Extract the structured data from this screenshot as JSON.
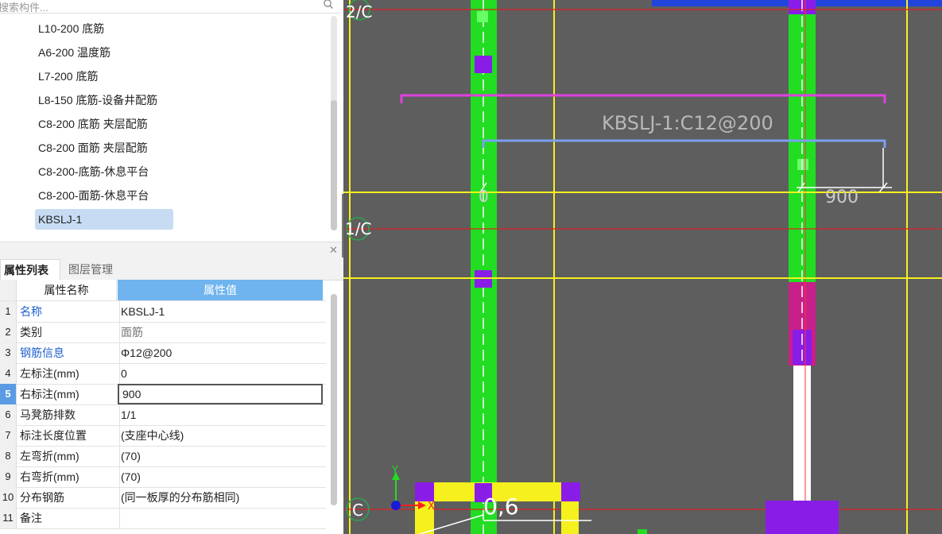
{
  "search": {
    "placeholder": "搜索构件..."
  },
  "tree": {
    "items": [
      "L10-200 底筋",
      "A6-200 温度筋",
      "L7-200 底筋",
      "L8-150 底筋-设备井配筋",
      "C8-200 底筋 夹层配筋",
      "C8-200 面筋 夹层配筋",
      "C8-200-底筋-休息平台",
      "C8-200-面筋-休息平台",
      "KBSLJ-1"
    ],
    "selected": "KBSLJ-1"
  },
  "tabs": {
    "properties": "属性列表",
    "layers": "图层管理"
  },
  "grid": {
    "header": {
      "name": "属性名称",
      "value": "属性值"
    },
    "rows": [
      {
        "num": "1",
        "name": "名称",
        "value": "KBSLJ-1"
      },
      {
        "num": "2",
        "name": "类别",
        "value": "面筋"
      },
      {
        "num": "3",
        "name": "钢筋信息",
        "value": "Φ12@200"
      },
      {
        "num": "4",
        "name": "左标注(mm)",
        "value": "0"
      },
      {
        "num": "5",
        "name": "右标注(mm)",
        "value": "900"
      },
      {
        "num": "6",
        "name": "马凳筋排数",
        "value": "1/1"
      },
      {
        "num": "7",
        "name": "标注长度位置",
        "value": "(支座中心线)"
      },
      {
        "num": "8",
        "name": "左弯折(mm)",
        "value": "(70)"
      },
      {
        "num": "9",
        "name": "右弯折(mm)",
        "value": "(70)"
      },
      {
        "num": "10",
        "name": "分布钢筋",
        "value": "(同一板厚的分布筋相同)"
      },
      {
        "num": "11",
        "name": "备注",
        "value": ""
      }
    ]
  },
  "cad": {
    "axis_labels": {
      "top": "2/C",
      "mid": "1/C",
      "bottom": "C"
    },
    "rebar_label": "KBSLJ-1:C12@200",
    "left_dim": "0",
    "right_dim": "900",
    "bottom_text": "0,6",
    "axis_x": "X",
    "axis_y": "Y"
  },
  "colors": {
    "canvas_bg": "#5e5e5e",
    "green": "#22dd22",
    "yellow": "#f5f01e",
    "red_line": "#e02020",
    "magenta": "#e040e0",
    "purple": "#8a1ce8",
    "rebar_blue": "#7aa0f0"
  }
}
